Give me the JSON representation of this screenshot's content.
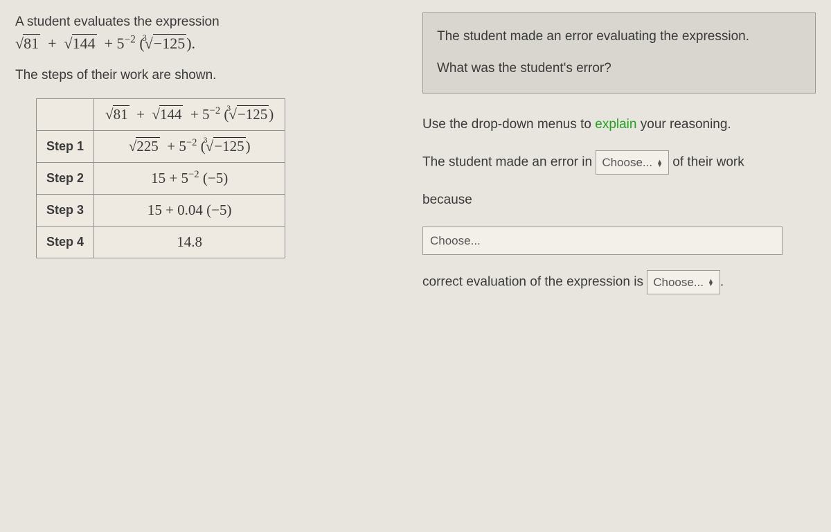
{
  "left": {
    "intro": "A student evaluates the expression",
    "sub": "The steps of their work are shown.",
    "expr": {
      "sqrt81": "81",
      "sqrt144": "144",
      "five_exp": "−2",
      "cbrt_inner": "−125"
    },
    "table": {
      "step1_label": "Step 1",
      "step2_label": "Step 2",
      "step3_label": "Step 3",
      "step4_label": "Step 4",
      "row0": {
        "sqrt81": "81",
        "sqrt144": "144",
        "five_exp": "−2",
        "cbrt_inner": "−125"
      },
      "row1": {
        "sqrt225": "225",
        "five_exp": "−2",
        "cbrt_inner": "−125"
      },
      "row2": {
        "a": "15",
        "five_exp": "−2",
        "paren": "(−5)"
      },
      "row3": {
        "a": "15",
        "b": "0.04",
        "paren": "(−5)"
      },
      "row4": "14.8"
    }
  },
  "right": {
    "box_line1": "The student made an error evaluating the expression.",
    "box_line2": "What was the student's error?",
    "instruction_pre": "Use the drop-down menus to ",
    "instruction_green": "explain",
    "instruction_post": " your reasoning.",
    "sentence1_pre": "The student made an error in ",
    "dropdown_placeholder": "Choose...",
    "sentence1_post": " of their work",
    "because": "because",
    "sentence3_pre": "correct evaluation of the expression is ",
    "period": "."
  }
}
